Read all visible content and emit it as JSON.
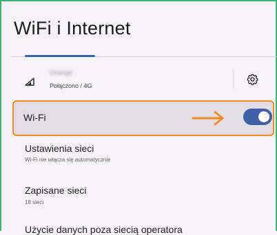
{
  "header": {
    "title": "WiFi i Internet"
  },
  "carrier": {
    "name": "Orange",
    "status": "Połączono / 4G"
  },
  "wifi": {
    "label": "Wi-Fi",
    "enabled": true,
    "highlight_color": "#f08a24",
    "toggle_color": "#3f5fa8"
  },
  "items": [
    {
      "title": "Ustawienia sieci",
      "subtitle": "Wi-Fi nie włącza się automatycznie"
    },
    {
      "title": "Zapisane sieci",
      "subtitle": "18 sieci"
    },
    {
      "title": "Użycie danych poza siecią operatora",
      "subtitle": ""
    }
  ],
  "icons": {
    "signal": "cellular-signal-icon",
    "settings": "gear-icon",
    "annotation": "arrow-right-icon"
  }
}
